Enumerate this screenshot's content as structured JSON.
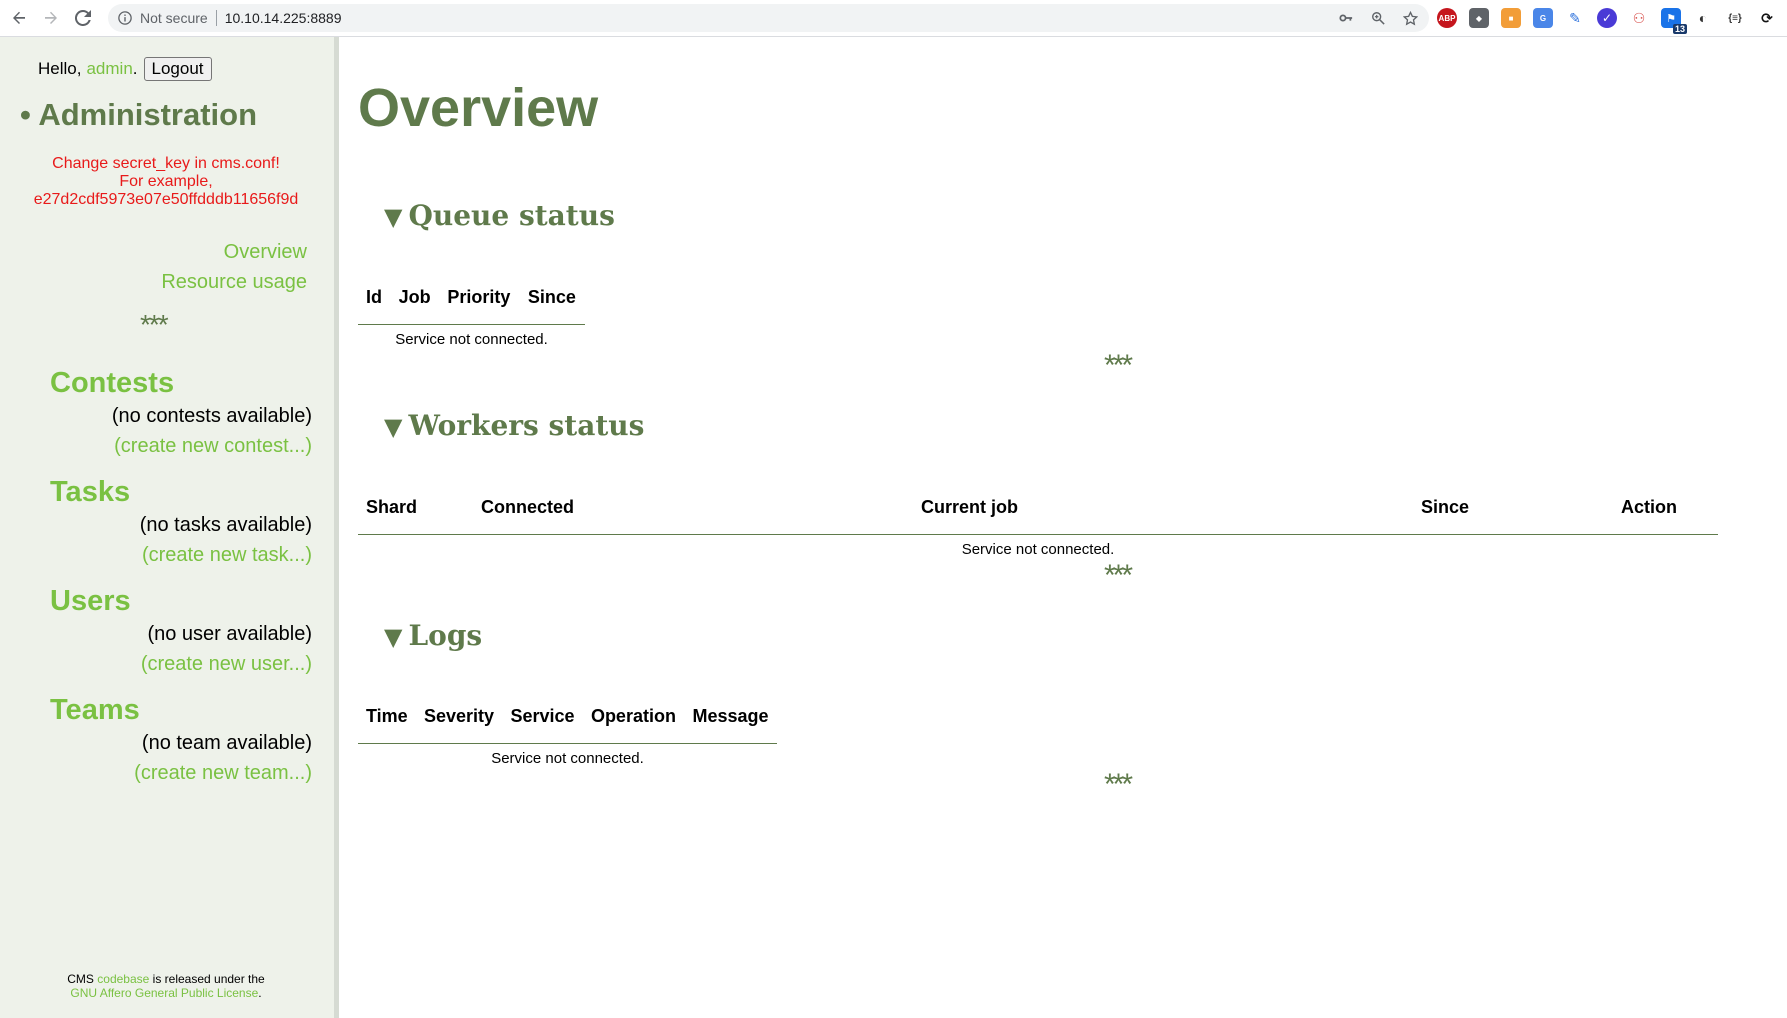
{
  "browser": {
    "security_label": "Not secure",
    "url": "10.10.14.225:8889",
    "extension_badge": "13"
  },
  "sidebar": {
    "greeting": "Hello,",
    "username": "admin",
    "greeting_end": ".",
    "logout_label": "Logout",
    "admin_title": "• Administration",
    "warning_line1": "Change secret_key in cms.conf!",
    "warning_line2": "For example,",
    "warning_line3": "e27d2cdf5973e07e50ffdddb11656f9d",
    "nav": [
      "Overview",
      "Resource usage"
    ],
    "stars": "***",
    "sections": [
      {
        "title": "Contests",
        "empty": "(no contests available)",
        "create": "(create new contest...)"
      },
      {
        "title": "Tasks",
        "empty": "(no tasks available)",
        "create": "(create new task...)"
      },
      {
        "title": "Users",
        "empty": "(no user available)",
        "create": "(create new user...)"
      },
      {
        "title": "Teams",
        "empty": "(no team available)",
        "create": "(create new team...)"
      }
    ],
    "footer_prefix": "CMS",
    "footer_link1": "codebase",
    "footer_mid": "is released under the",
    "footer_link2": "GNU Affero General Public License",
    "footer_end": "."
  },
  "main": {
    "title": "Overview",
    "queue": {
      "title": "Queue status",
      "columns": [
        "Id",
        "Job",
        "Priority",
        "Since"
      ],
      "message": "Service not connected."
    },
    "workers": {
      "title": "Workers status",
      "columns": [
        "Shard",
        "Connected",
        "Current job",
        "Since",
        "Action"
      ],
      "message": "Service not connected."
    },
    "logs": {
      "title": "Logs",
      "columns": [
        "Time",
        "Severity",
        "Service",
        "Operation",
        "Message"
      ],
      "message": "Service not connected."
    },
    "stars": "***"
  }
}
